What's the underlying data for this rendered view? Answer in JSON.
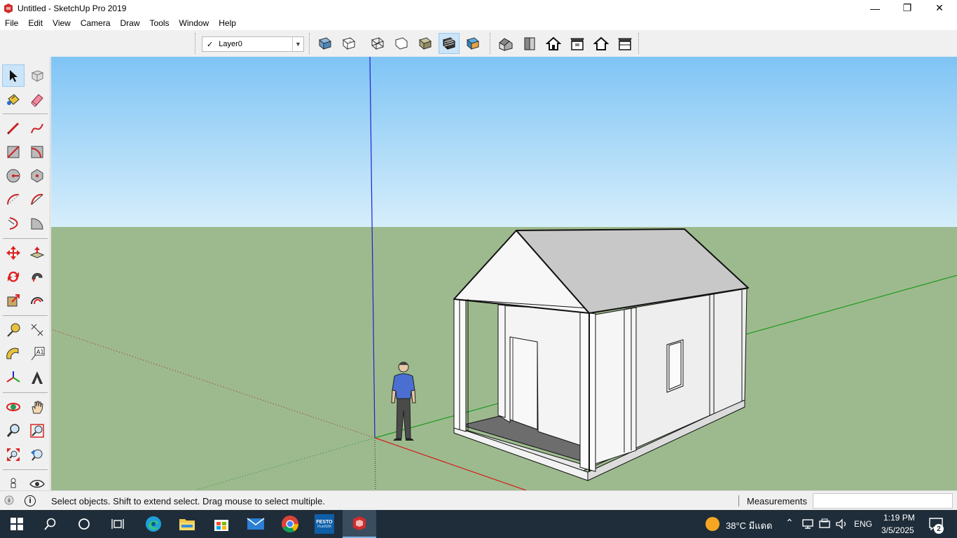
{
  "window": {
    "title": "Untitled - SketchUp Pro 2019",
    "minimize_glyph": "—",
    "maximize_glyph": "❐",
    "close_glyph": "✕"
  },
  "menu": [
    "File",
    "Edit",
    "View",
    "Camera",
    "Draw",
    "Tools",
    "Window",
    "Help"
  ],
  "layer": {
    "check": "✓",
    "name": "Layer0",
    "dropdown_glyph": "▼"
  },
  "toolbar_icons": [
    "x-ray-icon",
    "back-edges-icon",
    "wireframe-icon",
    "hidden-line-icon",
    "shaded-icon",
    "shaded-textures-icon",
    "monochrome-icon",
    "iso-view-icon",
    "top-view-icon",
    "front-view-icon",
    "right-view-icon",
    "back-view-icon",
    "left-view-icon"
  ],
  "left_tool_icons": [
    "select-icon",
    "make-component-icon",
    "paint-bucket-icon",
    "eraser-icon",
    "line-icon",
    "freehand-icon",
    "rectangle-icon",
    "rotated-rectangle-icon",
    "circle-icon",
    "polygon-icon",
    "arc-icon",
    "two-point-arc-icon",
    "three-point-arc-icon",
    "pie-icon",
    "move-icon",
    "push-pull-icon",
    "rotate-icon",
    "follow-me-icon",
    "scale-icon",
    "offset-icon",
    "tape-measure-icon",
    "dimension-icon",
    "protractor-icon",
    "text-icon",
    "axes-icon",
    "3d-text-icon",
    "orbit-icon",
    "pan-icon",
    "zoom-icon",
    "zoom-window-icon",
    "zoom-extents-icon",
    "previous-view-icon",
    "position-camera-icon",
    "look-around-icon"
  ],
  "status": {
    "message": "Select objects. Shift to extend select. Drag mouse to select multiple.",
    "measurements_label": "Measurements",
    "measurements_value": "",
    "info_glyph": "i"
  },
  "taskbar": {
    "icons": [
      "start-icon",
      "search-icon",
      "cortana-icon",
      "task-view-icon",
      "edge-icon",
      "file-explorer-icon",
      "store-icon",
      "mail-icon",
      "chrome-icon",
      "festo-icon",
      "sketchup-icon"
    ],
    "festo_label": "FESTO",
    "festo_sub": "FluidSIM",
    "weather": "38°C  มีแดด",
    "language": "ENG",
    "time": "1:19 PM",
    "date": "3/5/2025",
    "notifications": "2"
  },
  "colors": {
    "sky_top": "#7fc4f5",
    "sky_bottom": "#d6eefb",
    "ground": "#9dba8e",
    "axis_red": "#d22020",
    "axis_green": "#2aa52a",
    "axis_blue": "#2020d0",
    "taskbar": "#1f2d3a"
  }
}
